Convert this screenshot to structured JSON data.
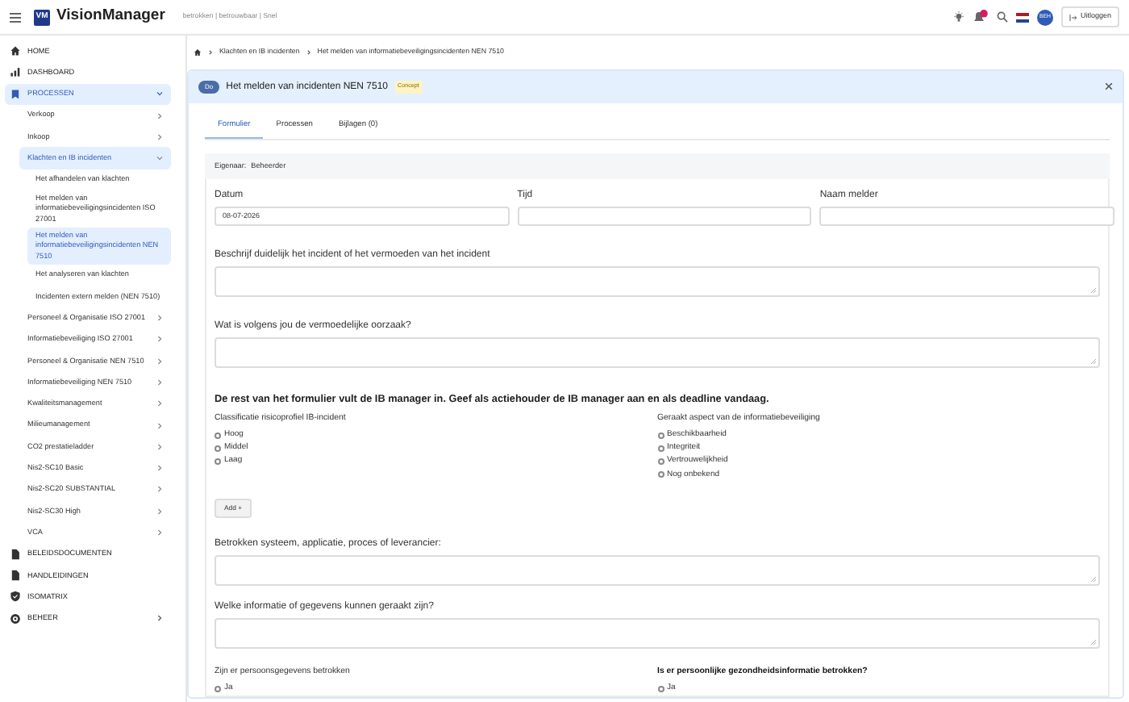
{
  "app": {
    "logo": "VM",
    "name": "VisionManager",
    "tagline": "betrokken | betrouwbaar | Snel"
  },
  "topbar": {
    "avatar": "BEH",
    "logout": "Uitloggen"
  },
  "sidebar": {
    "items": [
      {
        "label": "HOME",
        "selected": false
      },
      {
        "label": "DASHBOARD",
        "selected": false
      },
      {
        "label": "PROCESSEN",
        "selected": true,
        "expanded": true,
        "children": [
          {
            "label": "Verkoop",
            "selected": false,
            "expanded": false
          },
          {
            "label": "Inkoop",
            "selected": false,
            "expanded": false
          },
          {
            "label": "Klachten en IB incidenten",
            "selected": true,
            "expanded": true,
            "children": [
              {
                "label": "Het afhandelen van klachten",
                "selected": false
              },
              {
                "label": "Het melden van informatiebeveiligingsincidenten ISO 27001",
                "selected": false
              },
              {
                "label": "Het melden van informatiebeveiligingsincidenten NEN 7510",
                "selected": true
              },
              {
                "label": "Het analyseren van klachten",
                "selected": false
              },
              {
                "label": "Incidenten extern melden (NEN 7510)",
                "selected": false
              }
            ]
          },
          {
            "label": "Personeel & Organisatie ISO 27001",
            "selected": false,
            "expanded": false
          },
          {
            "label": "Informatiebeveiliging ISO 27001",
            "selected": false,
            "expanded": false
          },
          {
            "label": "Personeel & Organisatie NEN 7510",
            "selected": false,
            "expanded": false
          },
          {
            "label": "Informatiebeveiliging NEN 7510",
            "selected": false,
            "expanded": false
          },
          {
            "label": "Kwaliteitsmanagement",
            "selected": false,
            "expanded": false
          },
          {
            "label": "Milieumanagement",
            "selected": false,
            "expanded": false
          },
          {
            "label": "CO2 prestatieladder",
            "selected": false,
            "expanded": false
          },
          {
            "label": "Nis2-SC10 Basic",
            "selected": false,
            "expanded": false
          },
          {
            "label": "Nis2-SC20 SUBSTANTIAL",
            "selected": false,
            "expanded": false
          },
          {
            "label": "Nis2-SC30 High",
            "selected": false,
            "expanded": false
          },
          {
            "label": "VCA",
            "selected": false,
            "expanded": false
          }
        ]
      },
      {
        "label": "BELEIDSDOCUMENTEN",
        "selected": false
      },
      {
        "label": "HANDLEIDINGEN",
        "selected": false
      },
      {
        "label": "ISOMATRIX",
        "selected": false
      },
      {
        "label": "BEHEER",
        "selected": false,
        "expanded": false
      }
    ]
  },
  "breadcrumb": [
    "Klachten en IB incidenten",
    "Het melden van informatiebeveiligingsincidenten NEN 7510"
  ],
  "header": {
    "phase": "Do",
    "title": "Het melden van incidenten NEN 7510",
    "status": "Concept"
  },
  "tabs": [
    {
      "label": "Formulier",
      "selected": true
    },
    {
      "label": "Processen",
      "selected": false
    },
    {
      "label": "Bijlagen (0)",
      "selected": false
    }
  ],
  "owner": {
    "label": "Eigenaar:",
    "value": "Beheerder"
  },
  "form": [
    {
      "kind": "fields",
      "fields": [
        {
          "label": "Datum",
          "value": "08-07-2026"
        },
        {
          "label": "Tijd"
        },
        {
          "label": "Naam melder"
        }
      ]
    },
    {
      "kind": "textarea",
      "label": "Beschrijf duidelijk het incident of het vermoeden van het incident"
    },
    {
      "kind": "textarea",
      "label": "Wat is volgens jou de vermoedelijke oorzaak?"
    },
    {
      "kind": "heading",
      "text": "De rest van het formulier vult de IB manager in. Geef als actiehouder de IB manager aan en als deadline vandaag."
    },
    {
      "kind": "radios",
      "groups": [
        {
          "label": "Classificatie risicoprofiel IB-incident",
          "bold": false,
          "options": [
            {
              "label": "Hoog",
              "checked": false
            },
            {
              "label": "Middel",
              "checked": false
            },
            {
              "label": "Laag",
              "checked": false
            }
          ]
        },
        {
          "label": "Geraakt aspect van de informatiebeveiliging",
          "bold": false,
          "options": [
            {
              "label": "Beschikbaarheid",
              "checked": false
            },
            {
              "label": "Integriteit",
              "checked": false
            },
            {
              "label": "Vertrouwelijkheid",
              "checked": false
            },
            {
              "label": "Nog onbekend",
              "checked": false
            }
          ]
        }
      ]
    },
    {
      "kind": "button",
      "label": "Add +"
    },
    {
      "kind": "textarea",
      "label": "Betrokken systeem, applicatie, proces of leverancier:"
    },
    {
      "kind": "textarea",
      "label": "Welke informatie of gegevens kunnen geraakt zijn?"
    },
    {
      "kind": "radios",
      "groups": [
        {
          "label": "Zijn er persoonsgegevens betrokken",
          "bold": false,
          "options": [
            {
              "label": "Ja",
              "checked": false
            }
          ]
        },
        {
          "label": "Is er persoonlijke gezondheidsinformatie betrokken?",
          "bold": true,
          "options": [
            {
              "label": "Ja",
              "checked": false
            }
          ]
        }
      ]
    }
  ]
}
